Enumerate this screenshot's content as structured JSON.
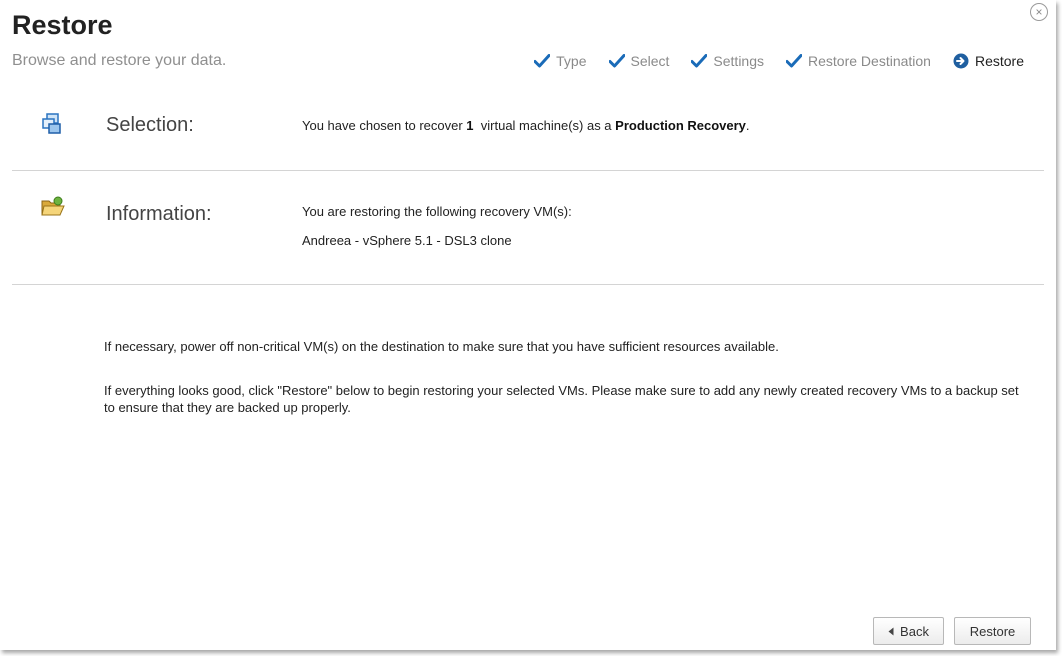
{
  "dialog": {
    "title": "Restore",
    "subtitle": "Browse and restore your data.",
    "close_glyph": "×"
  },
  "steps": [
    {
      "label": "Type",
      "state": "done",
      "icon": "checkmark-icon"
    },
    {
      "label": "Select",
      "state": "done",
      "icon": "checkmark-icon"
    },
    {
      "label": "Settings",
      "state": "done",
      "icon": "checkmark-icon"
    },
    {
      "label": "Restore Destination",
      "state": "done",
      "icon": "checkmark-icon"
    },
    {
      "label": "Restore",
      "state": "current",
      "icon": "arrow-right-circle-icon"
    }
  ],
  "selection": {
    "label": "Selection:",
    "icon": "virtual-machines-icon",
    "text_prefix": "You have chosen to recover ",
    "count": "1",
    "text_middle": "virtual machine(s) as a ",
    "recovery_type": "Production Recovery",
    "text_suffix": "."
  },
  "information": {
    "label": "Information:",
    "icon": "open-folder-icon",
    "intro": "You are restoring the following recovery VM(s):",
    "vm_name": "Andreea - vSphere 5.1 - DSL3 clone"
  },
  "notes": {
    "power_off": "If necessary, power off non-critical VM(s) on the destination to make sure that you have sufficient resources available.",
    "restore_hint": "If everything looks good, click \"Restore\" below to begin restoring your selected VMs. Please make sure to add any newly created recovery VMs to a backup set to ensure that they are backed up properly."
  },
  "buttons": {
    "back_label": "Back",
    "restore_label": "Restore"
  },
  "colors": {
    "check_blue": "#1a6bb8",
    "current_step_circle": "#1f5fa0",
    "divider": "#d4d4d4"
  }
}
